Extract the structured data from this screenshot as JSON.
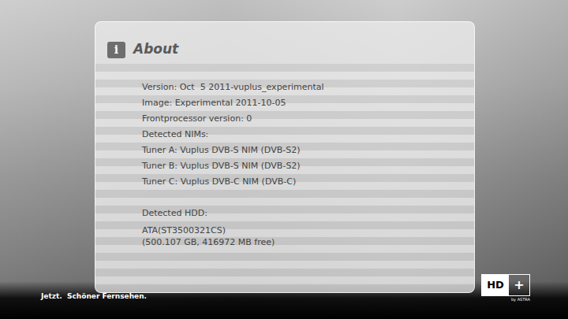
{
  "dialog": {
    "title": "About",
    "icon": "i"
  },
  "sections": [
    {
      "kind": "rows",
      "lines": [
        "Version: Oct  5 2011-vuplus_experimental",
        "Image: Experimental 2011-10-05",
        "Frontprocessor version: 0",
        "Detected NIMs:",
        "Tuner A: Vuplus DVB-S NIM (DVB-S2)",
        "Tuner B: Vuplus DVB-S NIM (DVB-S2)",
        "Tuner C: Vuplus DVB-C NIM (DVB-C)"
      ]
    },
    {
      "kind": "rows",
      "lines": [
        "Detected HDD:"
      ]
    },
    {
      "kind": "text",
      "lines": [
        "ATA(ST3500321CS)",
        "(500.107 GB, 416972 MB free)"
      ]
    }
  ],
  "branding": {
    "slogan": "Jetzt.  Schöner Fernsehen.",
    "logo_left": "HD",
    "logo_right": "+",
    "logo_sub": "by ASTRA"
  }
}
